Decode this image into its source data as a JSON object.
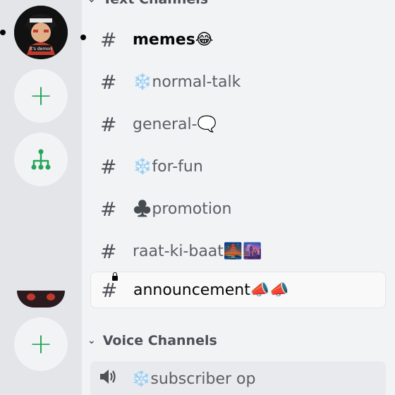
{
  "categories": {
    "text": "Text Channels",
    "voice": "Voice Channels"
  },
  "text_channels": [
    {
      "name": "memes😂",
      "unread": true
    },
    {
      "name": "❄️normal-talk"
    },
    {
      "name": "general-🗨️"
    },
    {
      "name": "❄️for-fun"
    },
    {
      "name": "♣️promotion"
    },
    {
      "name": "raat-ki-baat🌉🌆"
    },
    {
      "name": "announcement📣📣",
      "locked": true,
      "selected": true
    }
  ],
  "voice_channels": [
    {
      "name": "❄️subscriber op"
    }
  ],
  "server_rail": {
    "avatar_text": "it's demon",
    "icons": [
      "server-avatar",
      "add-server-icon",
      "discover-hub-icon",
      "server-avatar-partial",
      "add-server-icon"
    ]
  },
  "colors": {
    "rail_bg": "#e3e5e8",
    "list_bg": "#f2f3f5",
    "green": "#23a55a",
    "text_muted": "#5c5e66",
    "text_strong": "#060607"
  }
}
